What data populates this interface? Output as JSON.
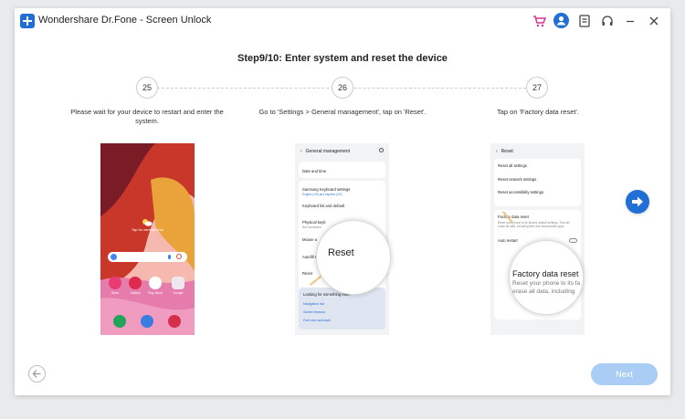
{
  "app": {
    "title": "Wondershare Dr.Fone - Screen Unlock"
  },
  "header": {
    "step_title": "Step9/10: Enter system and reset the device"
  },
  "steps": [
    {
      "number": "25",
      "description": "Please wait for your device to restart and enter the system."
    },
    {
      "number": "26",
      "description": "Go to 'Settings > General management', tap on 'Reset'."
    },
    {
      "number": "27",
      "description": "Tap on  'Factory data reset'."
    }
  ],
  "phone1": {
    "weather_hint": "Tap for weather info",
    "apps": [
      "Store",
      "Gallery",
      "Play Store",
      "Google"
    ]
  },
  "phone2": {
    "header": "General management",
    "items": [
      {
        "label": "Date and time"
      },
      {
        "label": "Samsung Keyboard settings",
        "sub": "English (US) and español (US)"
      },
      {
        "label": "Keyboard list and default"
      },
      {
        "label": "Physical keyb",
        "sub": "Not connected"
      },
      {
        "label": "Mouse a"
      },
      {
        "label": "Autofill s"
      },
      {
        "label": "Reset"
      }
    ],
    "looking_title": "Looking for something else?",
    "links": [
      "Navigation bar",
      "Screen timeout",
      "Font size and style"
    ],
    "magnified": "Reset"
  },
  "phone3": {
    "header": "Reset",
    "items": [
      {
        "label": "Reset all settings"
      },
      {
        "label": "Reset network settings"
      },
      {
        "label": "Reset accessibility settings"
      },
      {
        "label": "Factory data reset",
        "sub": "Reset your phone to its factory default settings. This will erase all data, including files and downloaded apps."
      },
      {
        "label": "Auto restart"
      }
    ],
    "magnified_title": "Factory data reset",
    "magnified_line1": "Reset your phone to its fa",
    "magnified_line2": "erase all data, including"
  },
  "footer": {
    "next_label": "Next"
  },
  "colors": {
    "accent": "#1f6fd6",
    "next_disabled": "#a9cdf4",
    "cart": "#d6358c"
  },
  "icons": [
    "cart-icon",
    "user-icon",
    "feedback-icon",
    "support-icon",
    "minimize-icon",
    "close-icon",
    "back-arrow-icon",
    "forward-arrow-icon"
  ]
}
